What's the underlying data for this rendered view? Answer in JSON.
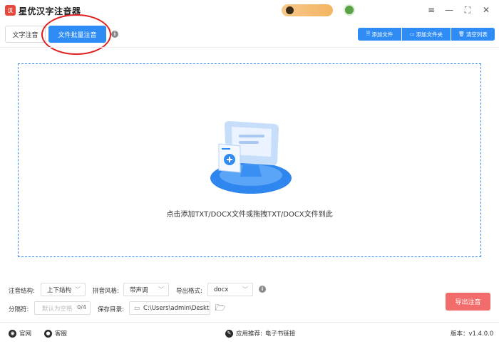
{
  "app": {
    "title": "星优汉字注音器",
    "logo_text": "汉"
  },
  "header": {
    "window_controls": {
      "menu": "≡",
      "minimize": "—",
      "maximize": "⛶",
      "close": "✕"
    }
  },
  "tabs": [
    {
      "label": "文字注音",
      "active": false
    },
    {
      "label": "文件批量注音",
      "active": true
    }
  ],
  "toolbar": {
    "add_file": "添加文件",
    "add_folder": "添加文件夹",
    "clear_list": "清空列表"
  },
  "dropzone": {
    "hint": "点击添加TXT/DOCX文件或拖拽TXT/DOCX文件到此"
  },
  "settings": {
    "structure": {
      "label": "注音结构:",
      "value": "上下结构"
    },
    "pinyin_style": {
      "label": "拼音风格:",
      "value": "带声调"
    },
    "export_format": {
      "label": "导出格式:",
      "value": "docx"
    },
    "separator": {
      "label": "分隔符:",
      "placeholder": "默认为空格",
      "count": "0/4"
    },
    "save_dir": {
      "label": "保存目录:",
      "value": "C:\\Users\\admin\\Deskto"
    },
    "export_button": "导出注音"
  },
  "footer": {
    "website": "官网",
    "support": "客服",
    "recommend_label": "应用推荐:",
    "recommend_value": "电子书链接",
    "version": "版本：v1.4.0.0"
  },
  "colors": {
    "accent": "#2f8cf5",
    "export": "#f26c6c",
    "highlight_ring": "#e02020"
  }
}
